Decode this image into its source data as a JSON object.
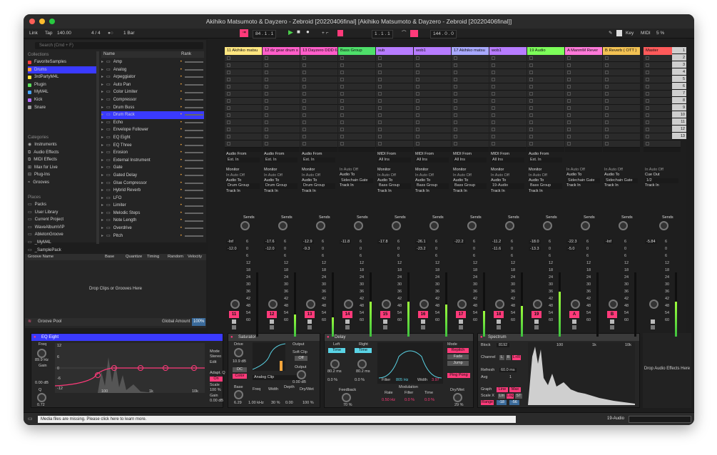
{
  "window": {
    "title": "Akihiko Matsumoto & Dayzero - Zebroid [20220406final]  [Akihiko Matsumoto & Dayzero - Zebroid [20220406final]]"
  },
  "control_bar": {
    "link": "Link",
    "tap": "Tap",
    "tempo": "140.00",
    "sig": "4 / 4",
    "quant": "1 Bar",
    "position": "84 . 1 . 1",
    "loop_start": "1 . 1 . 1",
    "loop_len": "144 . 0 . 0",
    "key": "Key",
    "midi": "MIDI",
    "cpu": "5 %"
  },
  "browser": {
    "search_placeholder": "Search (Cmd + F)",
    "collections_h": "Collections",
    "collections": [
      "FavoriteSamples",
      "Drums",
      "3rdPartyM4L",
      "Plugin",
      "MyM4L",
      "Kick",
      "Snare"
    ],
    "categories_h": "Categories",
    "categories": [
      "Instruments",
      "Audio Effects",
      "MIDI Effects",
      "Max for Live",
      "Plug-Ins",
      "Grooves"
    ],
    "places_h": "Places",
    "places": [
      "Packs",
      "User Library",
      "Current Project",
      "WaveAlbumVIP",
      "AbletonGroove",
      "_MyM4L",
      "_SamplePack"
    ],
    "col_name": "Name",
    "col_rank": "Rank",
    "items": [
      "Amp",
      "Analog",
      "Arpeggiator",
      "Auto Pan",
      "Color Limiter",
      "Compressor",
      "Drum Buss",
      "Drum Rack",
      "Echo",
      "Envelope Follower",
      "EQ Eight",
      "EQ Three",
      "Erosion",
      "External Instrument",
      "Gate",
      "Gated Delay",
      "Glue Compressor",
      "Hybrid Reverb",
      "LFO",
      "Limiter",
      "Melodic Steps",
      "Note Length",
      "Overdrive",
      "Pitch"
    ]
  },
  "groove": {
    "cols": [
      "Groove Name",
      "Base",
      "Quantize",
      "Timing",
      "Random",
      "Velocity"
    ],
    "drop": "Drop Clips or Grooves Here",
    "pool": "Groove Pool",
    "global": "Global Amount",
    "global_val": "100%"
  },
  "tracks": [
    {
      "name": "11 Akihiko matsu",
      "color": "#ffe680",
      "io1": "Audio From",
      "io2": "Ext. In",
      "io3": "Monitor",
      "io4": "Audio To",
      "io5": "Drum Group",
      "vol": "-Inf",
      "pan": "-12.0",
      "num": "11"
    },
    {
      "name": "12 dz gear drum s",
      "color": "#ff5ec9",
      "io1": "Audio From",
      "io2": "Ext. In",
      "io3": "Monitor",
      "io4": "Audio To",
      "io5": "Drum Group",
      "vol": "-17.6",
      "pan": "-12.0",
      "num": "12"
    },
    {
      "name": "13 Dayzero DDD 6",
      "color": "#ff5ec9",
      "io1": "Audio From",
      "io2": "Ext. In",
      "io3": "Monitor",
      "io4": "Audio To",
      "io5": "Drum Group",
      "vol": "-12.9",
      "pan": "-9.3",
      "num": "13"
    },
    {
      "name": "Bass Group",
      "color": "#4ee06a",
      "io1": "",
      "io2": "",
      "io3": "",
      "io4": "Audio To",
      "io5": "Sidechain Gate",
      "vol": "-11.8",
      "pan": "",
      "num": "14"
    },
    {
      "name": "sub",
      "color": "#b77cff",
      "io1": "MIDI From",
      "io2": "All Ins",
      "io3": "Monitor",
      "io4": "Audio To",
      "io5": "Bass Group",
      "vol": "-17.8",
      "pan": "",
      "num": "15"
    },
    {
      "name": "wob1",
      "color": "#b77cff",
      "io1": "MIDI From",
      "io2": "All Ins",
      "io3": "Monitor",
      "io4": "Audio To",
      "io5": "Bass Group",
      "vol": "-26.1",
      "pan": "-23.2",
      "num": "16"
    },
    {
      "name": "17 Akihiko matsu",
      "color": "#a9a9ff",
      "io1": "MIDI From",
      "io2": "All Ins",
      "io3": "Monitor",
      "io4": "Audio To",
      "io5": "Bass Group",
      "vol": "-22.2",
      "pan": "",
      "num": "17"
    },
    {
      "name": "wob1",
      "color": "#b77cff",
      "io1": "MIDI From",
      "io2": "All Ins",
      "io3": "Monitor",
      "io4": "Audio To",
      "io5": "19-Audio",
      "vol": "-11.2",
      "pan": "-11.6",
      "num": "18"
    },
    {
      "name": "19 Audio",
      "color": "#7dff5a",
      "io1": "Audio From",
      "io2": "Ext. In",
      "io3": "Monitor",
      "io4": "Audio To",
      "io5": "Bass Group",
      "vol": "-18.0",
      "pan": "-13.3",
      "num": "19"
    },
    {
      "name": "A ManmM Rever",
      "color": "#ff7ad9",
      "io1": "",
      "io2": "",
      "io3": "",
      "io4": "Audio To",
      "io5": "Sidechain Gate",
      "vol": "-22.3",
      "pan": "-5.0",
      "num": "A"
    },
    {
      "name": "B Reverb ( OTT )",
      "color": "#f3c253",
      "io1": "",
      "io2": "",
      "io3": "",
      "io4": "Audio To",
      "io5": "Sidechain Gate",
      "vol": "-Inf",
      "pan": "",
      "num": "B"
    },
    {
      "name": "Master",
      "color": "#ff5a5a",
      "io1": "",
      "io2": "",
      "io3": "",
      "io4": "Cue Out",
      "io5": "1/2",
      "vol": "-5.84",
      "pan": "",
      "num": ""
    }
  ],
  "scale": [
    "6",
    "0",
    "6",
    "12",
    "18",
    "24",
    "30",
    "36",
    "42",
    "48",
    "54",
    "60"
  ],
  "sends": "Sends",
  "track_in": "Track In",
  "scene_nums": [
    "1",
    "2",
    "3",
    "4",
    "5",
    "6",
    "7",
    "8",
    "9",
    "10",
    "11",
    "12",
    "13"
  ],
  "devices": {
    "eq": {
      "name": "EQ Eight",
      "freq": "Freq",
      "freq_val": "89.9 Hz",
      "gain": "Gain",
      "gain_val": "0.00 dB",
      "q": "Q",
      "q_val": "0.72",
      "mode": "Mode",
      "mode_val": "Stereo",
      "edit": "Edit",
      "adapt": "Adapt. Q",
      "on": "On",
      "scale": "Scale",
      "scale_val": "100 %",
      "gain2": "Gain",
      "gain2_val": "0.00 dB",
      "ticks": [
        "12",
        "6",
        "0",
        "-6",
        "-12",
        "100",
        "1k",
        "10k"
      ]
    },
    "sat": {
      "name": "Saturator",
      "drive": "Drive",
      "drive_val": "10.9 dB",
      "dc": "DC",
      "color": "Color",
      "output": "Output",
      "soft": "Soft Clip",
      "off": "Off",
      "clip": "Analog Clip",
      "out_lbl": "Output",
      "out_val": "0.00 dB",
      "base": "Base",
      "base_val": "6.29",
      "freq": "Freq",
      "freq_val": "1.00 kHz",
      "width": "Width",
      "width_val": "30 %",
      "depth": "Depth",
      "depth_val": "0.00",
      "dw": "Dry/Wet",
      "dw_val": "100 %"
    },
    "delay": {
      "name": "Delay",
      "left": "Left",
      "right": "Right",
      "time": "Time",
      "l_val": "80.2 ms",
      "r_val": "80.2 ms",
      "l_off": "0.0 %",
      "r_off": "0.0 %",
      "feedback": "Feedback",
      "fb_val": "70 %",
      "filter": "Filter",
      "filter_val": "805 Hz",
      "width": "Width",
      "width_val": "3.97",
      "mode": "Mode",
      "repitch": "Repitch",
      "fade": "Fade",
      "jump": "Jump",
      "pingpong": "Ping Pong",
      "mod": "Modulation",
      "rate": "Rate",
      "rate_val": "0.50 Hz",
      "filt": "Filter",
      "filt_val": "0.0 %",
      "mtime": "Time",
      "mtime_val": "0.0 %",
      "dw": "Dry/Wet",
      "dw_val": "29 %"
    },
    "spec": {
      "name": "Spectrum",
      "block": "Block",
      "block_val": "8192",
      "channel": "Channel",
      "ch_l": "L",
      "ch_r": "R",
      "ch_lr": "L+R",
      "refresh": "Refresh",
      "refresh_val": "60.0 ms",
      "avg": "Avg",
      "avg_val": "1",
      "graph": "Graph",
      "line": "Line",
      "max": "Max",
      "scalex": "Scale X",
      "lin": "Lin",
      "log": "Log",
      "st": "ST",
      "range": "Range",
      "r1": "-18",
      "r2": "-56",
      "ticks": [
        "100",
        "1k",
        "10k"
      ]
    },
    "drop": "Drop Audio Effects Here"
  },
  "status": {
    "msg": "Media files are missing. Please click here to learn more.",
    "track": "19-Audio"
  },
  "colors": {
    "accent": "#ff3a7a",
    "select": "#3a3aff",
    "cyan": "#5ad4e6"
  }
}
